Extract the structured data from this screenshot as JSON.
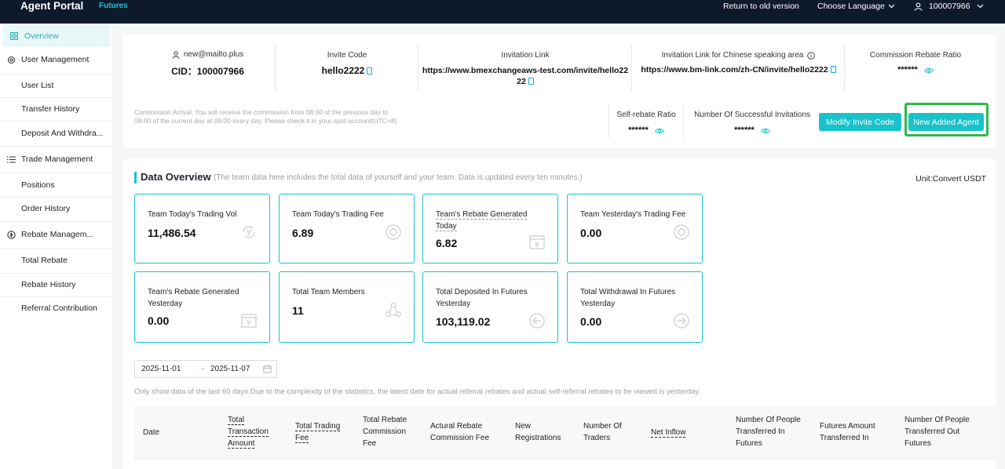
{
  "header": {
    "app_title": "Agent Portal",
    "product": "Futures",
    "return_link": "Return to old version",
    "language": "Choose Language",
    "user_id": "100007966"
  },
  "sidebar": {
    "items": [
      {
        "label": "Overview",
        "icon": "grid-icon"
      },
      {
        "label": "User Management",
        "icon": "gear-icon"
      },
      {
        "label": "User List"
      },
      {
        "label": "Transfer History"
      },
      {
        "label": "Deposit And Withdra..."
      },
      {
        "label": "Trade Management",
        "icon": "list-icon"
      },
      {
        "label": "Positions"
      },
      {
        "label": "Order History"
      },
      {
        "label": "Rebate Managem...",
        "icon": "coin-icon"
      },
      {
        "label": "Total Rebate"
      },
      {
        "label": "Rebate History"
      },
      {
        "label": "Referral Contribution"
      }
    ]
  },
  "account": {
    "email": "new@mailto.plus",
    "cid_label": "CID：",
    "cid": "100007966",
    "invite_code_label": "Invite Code",
    "invite_code": "hello2222",
    "invitation_link_label": "Invitation Link",
    "invitation_link_line1": "https://www.bmexchangeaws-test.com/invite/hello22",
    "invitation_link_line2": "22",
    "cn_link_label": "Invitation Link for Chinese speaking area",
    "cn_link": "https://www.bm-link.com/zh-CN/invite/hello2222",
    "commission_ratio_label": "Commission Rebate Ratio",
    "commission_ratio": "******",
    "commission_note": "Commission Arrival: You will receive the commission from 08:00 of the previous day to 08:00 of the current day at 09:00 every day. Please check it in your spot account(UTC+8)",
    "self_rebate_label": "Self-rebate Ratio",
    "self_rebate": "******",
    "successful_inv_label": "Number Of Successful Invitations",
    "successful_inv": "******",
    "modify_button": "Modify Invite Code",
    "new_agent_button": "New Added Agent"
  },
  "overview": {
    "title": "Data Overview",
    "subtitle": "(The team data here includes the total data of yourself and your team. Data is updated every ten minutes.)",
    "unit": "Unit:Convert USDT",
    "cards": [
      {
        "label": "Team Today's Trading Vol",
        "value": "11,486.54",
        "icon": "yuan-cycle-icon"
      },
      {
        "label": "Team Today's Trading Fee",
        "value": "6.89",
        "icon": "diamond-coin-icon"
      },
      {
        "label": "Team's Rebate Generated Today",
        "value": "6.82",
        "icon": "wallet-yuan-icon"
      },
      {
        "label": "Team Yesterday's Trading Fee",
        "value": "0.00",
        "icon": "diamond-coin-icon"
      },
      {
        "label": "Team's Rebate Generated Yesterday",
        "value": "0.00",
        "icon": "wallet-yuan-icon"
      },
      {
        "label": "Total Team Members",
        "value": "11",
        "icon": "team-icon"
      },
      {
        "label": "Total Deposited In Futures Yesterday",
        "value": "103,119.02",
        "icon": "arrow-in-icon"
      },
      {
        "label": "Total Withdrawal In Futures Yesterday",
        "value": "0.00",
        "icon": "arrow-out-icon"
      }
    ]
  },
  "filter": {
    "start_date": "2025-11-01",
    "end_date": "2025-11-07",
    "note": "Only show data of the last 60 days.Due to the complexity of the statistics, the latest date for actual referral rebates and actual self-referral rebates to be viewed is yesterday."
  },
  "table": {
    "columns": [
      "Date",
      "Total Transaction Amount",
      "Total Trading Fee",
      "Total Rebate Commission Fee",
      "Actural Rebate Commission Fee",
      "New Registrations",
      "Number Of Traders",
      "Net Inflow",
      "Number Of People Transferred In Futures",
      "Futures Amount Transferred In",
      "Number Of People Transferred Out Futures"
    ]
  }
}
